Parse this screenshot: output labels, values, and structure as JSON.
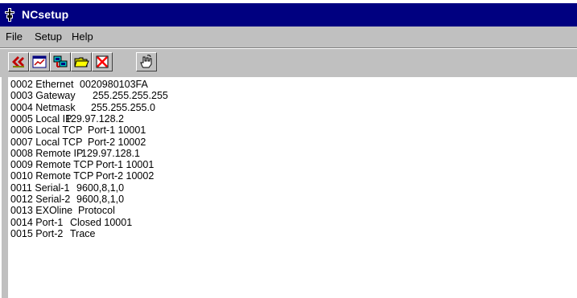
{
  "window": {
    "title": "NCsetup"
  },
  "menu": {
    "items": [
      "File",
      "Setup",
      "Help"
    ]
  },
  "toolbar": {
    "buttons": [
      {
        "icon": "connect-icon"
      },
      {
        "icon": "chart-icon"
      },
      {
        "icon": "network-icon"
      },
      {
        "icon": "open-folder-icon"
      },
      {
        "icon": "stop-icon"
      },
      {
        "icon": "help-pointer-icon"
      }
    ]
  },
  "log": {
    "lines": [
      {
        "label": "0002 Ethernet",
        "value": "0020980103FA"
      },
      {
        "label": "0003 Gateway",
        "value": "255.255.255.255"
      },
      {
        "label": "0004 Netmask",
        "value": "255.255.255.0"
      },
      {
        "label": "0005 Local IP",
        "value": "129.97.128.2"
      },
      {
        "label": "0006 Local TCP",
        "value": "Port-1 10001"
      },
      {
        "label": "0007 Local TCP",
        "value": "Port-2 10002"
      },
      {
        "label": "0008 Remote IP",
        "value": "129.97.128.1"
      },
      {
        "label": "0009 Remote TCP",
        "value": "Port-1 10001"
      },
      {
        "label": "0010 Remote TCP",
        "value": "Port-2 10002"
      },
      {
        "label": "0011 Serial-1",
        "value": "9600,8,1,0"
      },
      {
        "label": "0012 Serial-2",
        "value": "9600,8,1,0"
      },
      {
        "label": "0013 EXOline",
        "value": "Protocol"
      },
      {
        "label": "0014 Port-1",
        "value": "Closed 10001"
      },
      {
        "label": "0015 Port-2",
        "value": "Trace"
      }
    ]
  },
  "colors": {
    "titlebar": "#000080",
    "chrome": "#c0c0c0",
    "content_bg": "#ffffff"
  }
}
